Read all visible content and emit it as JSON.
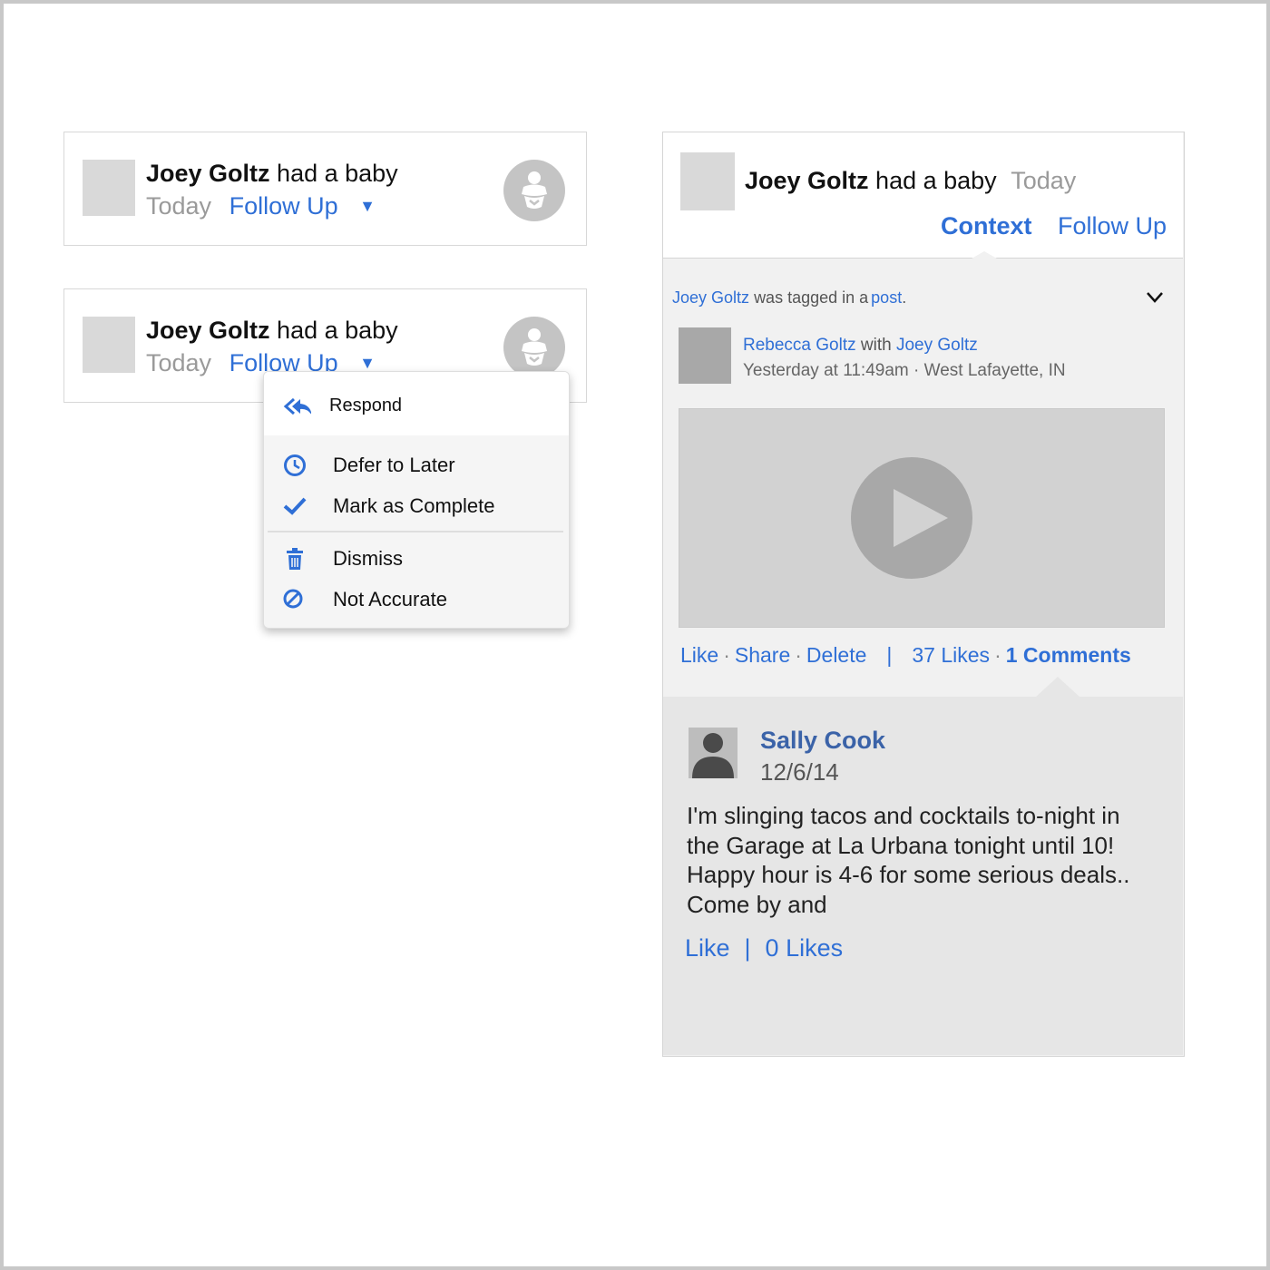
{
  "colors": {
    "link_blue": "#2f6fd6",
    "name_blue": "#3b63a8",
    "gray_text": "#9a9a9a",
    "placeholder": "#d9d9d9",
    "panel_bg": "#f1f1f1",
    "comment_bg": "#e6e6e6"
  },
  "card1": {
    "name": "Joey Goltz",
    "action": "had a baby",
    "time": "Today",
    "follow_up": "Follow Up",
    "caret": "▼",
    "icon": "baby-icon"
  },
  "card2": {
    "name": "Joey Goltz",
    "action": "had a baby",
    "time": "Today",
    "follow_up": "Follow Up",
    "caret": "▼",
    "icon": "baby-icon"
  },
  "menu": {
    "items": [
      {
        "label": "Respond",
        "icon": "reply-all-icon"
      },
      {
        "label": "Defer to Later",
        "icon": "clock-icon"
      },
      {
        "label": "Mark as Complete",
        "icon": "checkmark-icon"
      },
      {
        "label": "Dismiss",
        "icon": "trash-icon"
      },
      {
        "label": "Not Accurate",
        "icon": "prohibited-icon"
      }
    ]
  },
  "panel": {
    "name": "Joey Goltz",
    "action": "had a baby",
    "time": "Today",
    "tabs": {
      "context": "Context",
      "follow_up": "Follow Up"
    },
    "tagged": {
      "person": "Joey Goltz",
      "text": "was tagged in a",
      "link": "post",
      "end": "."
    },
    "post": {
      "author": "Rebecca Goltz",
      "with_text": "with",
      "tagged_person": "Joey Goltz",
      "time": "Yesterday at 11:49am · West Lafayette, IN"
    },
    "actions": {
      "like": "Like",
      "share": "Share",
      "delete": "Delete",
      "separator": "|",
      "likes_count": "37 Likes",
      "comments_count": "1 Comments"
    },
    "comment": {
      "author": "Sally Cook",
      "date": "12/6/14",
      "body": "I'm slinging tacos and cocktails to-night in the Garage at La Urbana tonight until 10! Happy hour is 4-6 for some serious deals.. Come by and",
      "like": "Like",
      "separator": "|",
      "likes": "0 Likes"
    }
  }
}
